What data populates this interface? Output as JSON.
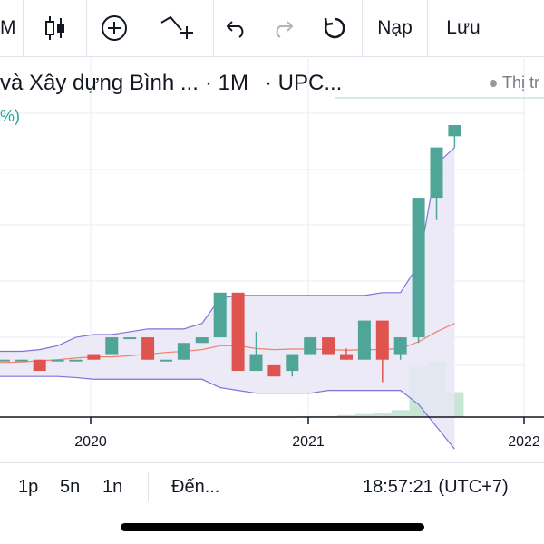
{
  "toolbar": {
    "interval_label": "M",
    "load_label": "Nạp",
    "save_label": "Lưu"
  },
  "legend": {
    "symbol": "và Xây dựng Bình ...",
    "resolution": "· 1M",
    "exchange": "· UPC...",
    "market_status": "Thị tr",
    "change_fragment": "%)"
  },
  "bottom": {
    "range_1": "1p",
    "range_2": "5n",
    "range_3": "1n",
    "goto": "Đến...",
    "clock": "18:57:21 (UTC+7)"
  },
  "colors": {
    "up": "#4fa597",
    "down": "#e0544f",
    "band_fill": "#e7e6f4",
    "band_line": "#7e74d8",
    "basis_line": "#f0826a",
    "volume": "#c8e6d6",
    "grid": "#eceef2"
  },
  "chart_data": {
    "type": "candlestick",
    "x_ticks": [
      "2020",
      "2021",
      "2022"
    ],
    "y_range": [
      10,
      15
    ],
    "indicator": "Bollinger Bands",
    "candles": [
      {
        "o": 10.8,
        "h": 10.8,
        "l": 10.5,
        "c": 10.5
      },
      {
        "o": 10.8,
        "h": 10.8,
        "l": 10.8,
        "c": 10.8
      },
      {
        "o": 10.8,
        "h": 10.8,
        "l": 10.8,
        "c": 10.8
      },
      {
        "o": 10.8,
        "h": 10.8,
        "l": 10.6,
        "c": 10.6
      },
      {
        "o": 10.8,
        "h": 10.8,
        "l": 10.8,
        "c": 10.8
      },
      {
        "o": 10.8,
        "h": 10.8,
        "l": 10.8,
        "c": 10.8
      },
      {
        "o": 10.9,
        "h": 10.9,
        "l": 10.8,
        "c": 10.8
      },
      {
        "o": 10.9,
        "h": 11.2,
        "l": 10.9,
        "c": 11.2
      },
      {
        "o": 11.2,
        "h": 11.2,
        "l": 11.2,
        "c": 11.2
      },
      {
        "o": 11.2,
        "h": 11.2,
        "l": 10.8,
        "c": 10.8
      },
      {
        "o": 10.8,
        "h": 10.8,
        "l": 10.8,
        "c": 10.8
      },
      {
        "o": 10.8,
        "h": 11.1,
        "l": 10.8,
        "c": 11.1
      },
      {
        "o": 11.1,
        "h": 11.2,
        "l": 11.1,
        "c": 11.2
      },
      {
        "o": 11.2,
        "h": 12.0,
        "l": 11.2,
        "c": 12.0
      },
      {
        "o": 12.0,
        "h": 12.0,
        "l": 10.6,
        "c": 10.6
      },
      {
        "o": 10.6,
        "h": 11.3,
        "l": 10.6,
        "c": 10.9
      },
      {
        "o": 10.7,
        "h": 10.7,
        "l": 10.5,
        "c": 10.5
      },
      {
        "o": 10.6,
        "h": 10.9,
        "l": 10.5,
        "c": 10.9
      },
      {
        "o": 10.9,
        "h": 11.2,
        "l": 10.9,
        "c": 11.2
      },
      {
        "o": 11.2,
        "h": 11.2,
        "l": 10.9,
        "c": 10.9
      },
      {
        "o": 10.9,
        "h": 11.0,
        "l": 10.8,
        "c": 10.8
      },
      {
        "o": 10.8,
        "h": 11.5,
        "l": 10.8,
        "c": 11.5
      },
      {
        "o": 11.5,
        "h": 11.5,
        "l": 10.4,
        "c": 10.8
      },
      {
        "o": 10.9,
        "h": 11.2,
        "l": 10.8,
        "c": 11.2
      },
      {
        "o": 11.2,
        "h": 13.7,
        "l": 11.1,
        "c": 13.7
      },
      {
        "o": 13.7,
        "h": 14.6,
        "l": 13.3,
        "c": 14.6
      },
      {
        "o": 14.8,
        "h": 15.0,
        "l": 14.6,
        "c": 15.0
      }
    ],
    "bollinger_upper": [
      10.95,
      10.95,
      10.95,
      10.98,
      11.05,
      11.2,
      11.25,
      11.25,
      11.3,
      11.35,
      11.35,
      11.35,
      11.45,
      11.9,
      11.95,
      11.95,
      11.95,
      11.95,
      11.95,
      11.95,
      11.95,
      11.95,
      12.0,
      12.0,
      12.5,
      14.3,
      14.6
    ],
    "bollinger_basis": [
      10.75,
      10.75,
      10.76,
      10.78,
      10.8,
      10.83,
      10.85,
      10.85,
      10.87,
      10.9,
      10.93,
      10.95,
      10.98,
      11.05,
      11.05,
      11.0,
      10.98,
      10.99,
      10.99,
      10.98,
      10.97,
      10.98,
      10.98,
      11.0,
      11.12,
      11.3,
      11.45
    ],
    "bollinger_lower": [
      10.5,
      10.5,
      10.5,
      10.5,
      10.5,
      10.48,
      10.45,
      10.45,
      10.45,
      10.45,
      10.45,
      10.45,
      10.45,
      10.3,
      10.25,
      10.2,
      10.2,
      10.2,
      10.2,
      10.25,
      10.25,
      10.25,
      10.25,
      10.25,
      10.0,
      9.6,
      9.2
    ],
    "volume": [
      0,
      0,
      0,
      0,
      0,
      0,
      0,
      0,
      0,
      0,
      0,
      0,
      0,
      0,
      0,
      0,
      0,
      0,
      0.02,
      0.02,
      0.04,
      0.06,
      0.09,
      0.14,
      1.0,
      1.12,
      0.5
    ]
  }
}
